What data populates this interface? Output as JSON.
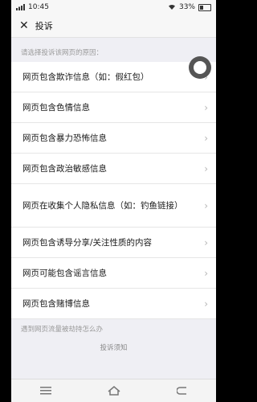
{
  "status": {
    "time": "10:45",
    "battery": "33%"
  },
  "header": {
    "close": "✕",
    "title": "投诉"
  },
  "hint": "请选择投诉该网页的原因：",
  "items": [
    "网页包含欺诈信息（如：假红包）",
    "网页包含色情信息",
    "网页包含暴力恐怖信息",
    "网页包含政治敏感信息",
    "网页在收集个人隐私信息（如：钓鱼链接）",
    "网页包含诱导分享/关注性质的内容",
    "网页可能包含谣言信息",
    "网页包含赌博信息"
  ],
  "footer_note": "遇到网页流量被劫持怎么办",
  "notice": "投诉须知",
  "chevron": "›"
}
